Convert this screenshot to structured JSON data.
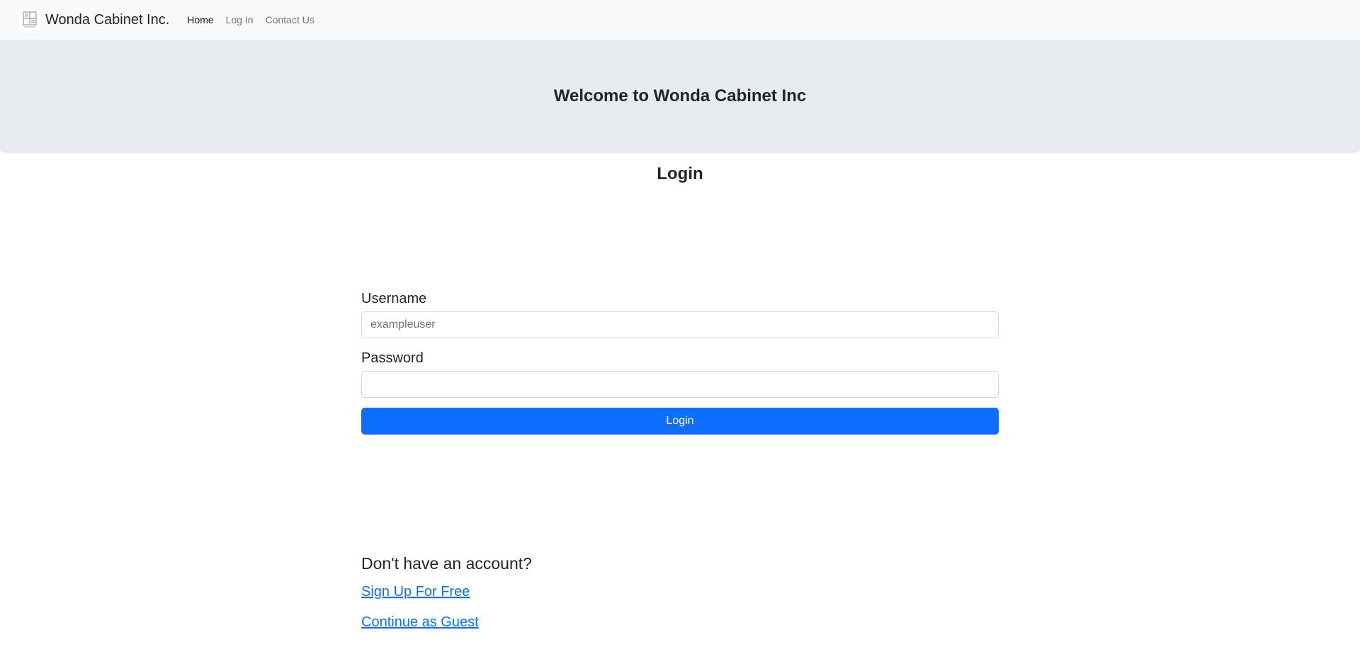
{
  "navbar": {
    "brand": "Wonda Cabinet Inc.",
    "logo_icon": "cabinet-logo-icon",
    "links": [
      {
        "label": "Home",
        "active": true
      },
      {
        "label": "Log In",
        "active": false
      },
      {
        "label": "Contact Us",
        "active": false
      }
    ]
  },
  "hero": {
    "title": "Welcome to Wonda Cabinet Inc"
  },
  "login": {
    "title": "Login",
    "username_label": "Username",
    "username_placeholder": "exampleuser",
    "username_value": "",
    "password_label": "Password",
    "password_value": "",
    "submit_label": "Login"
  },
  "account": {
    "question": "Don't have an account?",
    "signup_label": "Sign Up For Free",
    "guest_label": "Continue as Guest"
  },
  "colors": {
    "navbar_bg": "#f8f9fa",
    "hero_bg": "#e9ecef",
    "primary": "#0d6efd",
    "text": "#212529"
  }
}
